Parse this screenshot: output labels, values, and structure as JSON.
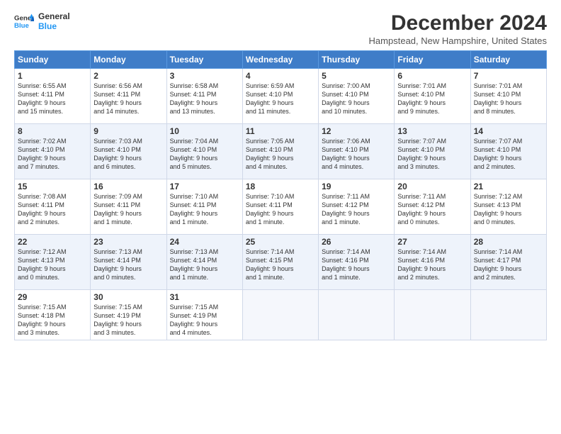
{
  "logo": {
    "line1": "General",
    "line2": "Blue"
  },
  "title": "December 2024",
  "location": "Hampstead, New Hampshire, United States",
  "days_of_week": [
    "Sunday",
    "Monday",
    "Tuesday",
    "Wednesday",
    "Thursday",
    "Friday",
    "Saturday"
  ],
  "weeks": [
    [
      {
        "day": "1",
        "info": "Sunrise: 6:55 AM\nSunset: 4:11 PM\nDaylight: 9 hours\nand 15 minutes."
      },
      {
        "day": "2",
        "info": "Sunrise: 6:56 AM\nSunset: 4:11 PM\nDaylight: 9 hours\nand 14 minutes."
      },
      {
        "day": "3",
        "info": "Sunrise: 6:58 AM\nSunset: 4:11 PM\nDaylight: 9 hours\nand 13 minutes."
      },
      {
        "day": "4",
        "info": "Sunrise: 6:59 AM\nSunset: 4:10 PM\nDaylight: 9 hours\nand 11 minutes."
      },
      {
        "day": "5",
        "info": "Sunrise: 7:00 AM\nSunset: 4:10 PM\nDaylight: 9 hours\nand 10 minutes."
      },
      {
        "day": "6",
        "info": "Sunrise: 7:01 AM\nSunset: 4:10 PM\nDaylight: 9 hours\nand 9 minutes."
      },
      {
        "day": "7",
        "info": "Sunrise: 7:01 AM\nSunset: 4:10 PM\nDaylight: 9 hours\nand 8 minutes."
      }
    ],
    [
      {
        "day": "8",
        "info": "Sunrise: 7:02 AM\nSunset: 4:10 PM\nDaylight: 9 hours\nand 7 minutes."
      },
      {
        "day": "9",
        "info": "Sunrise: 7:03 AM\nSunset: 4:10 PM\nDaylight: 9 hours\nand 6 minutes."
      },
      {
        "day": "10",
        "info": "Sunrise: 7:04 AM\nSunset: 4:10 PM\nDaylight: 9 hours\nand 5 minutes."
      },
      {
        "day": "11",
        "info": "Sunrise: 7:05 AM\nSunset: 4:10 PM\nDaylight: 9 hours\nand 4 minutes."
      },
      {
        "day": "12",
        "info": "Sunrise: 7:06 AM\nSunset: 4:10 PM\nDaylight: 9 hours\nand 4 minutes."
      },
      {
        "day": "13",
        "info": "Sunrise: 7:07 AM\nSunset: 4:10 PM\nDaylight: 9 hours\nand 3 minutes."
      },
      {
        "day": "14",
        "info": "Sunrise: 7:07 AM\nSunset: 4:10 PM\nDaylight: 9 hours\nand 2 minutes."
      }
    ],
    [
      {
        "day": "15",
        "info": "Sunrise: 7:08 AM\nSunset: 4:11 PM\nDaylight: 9 hours\nand 2 minutes."
      },
      {
        "day": "16",
        "info": "Sunrise: 7:09 AM\nSunset: 4:11 PM\nDaylight: 9 hours\nand 1 minute."
      },
      {
        "day": "17",
        "info": "Sunrise: 7:10 AM\nSunset: 4:11 PM\nDaylight: 9 hours\nand 1 minute."
      },
      {
        "day": "18",
        "info": "Sunrise: 7:10 AM\nSunset: 4:11 PM\nDaylight: 9 hours\nand 1 minute."
      },
      {
        "day": "19",
        "info": "Sunrise: 7:11 AM\nSunset: 4:12 PM\nDaylight: 9 hours\nand 1 minute."
      },
      {
        "day": "20",
        "info": "Sunrise: 7:11 AM\nSunset: 4:12 PM\nDaylight: 9 hours\nand 0 minutes."
      },
      {
        "day": "21",
        "info": "Sunrise: 7:12 AM\nSunset: 4:13 PM\nDaylight: 9 hours\nand 0 minutes."
      }
    ],
    [
      {
        "day": "22",
        "info": "Sunrise: 7:12 AM\nSunset: 4:13 PM\nDaylight: 9 hours\nand 0 minutes."
      },
      {
        "day": "23",
        "info": "Sunrise: 7:13 AM\nSunset: 4:14 PM\nDaylight: 9 hours\nand 0 minutes."
      },
      {
        "day": "24",
        "info": "Sunrise: 7:13 AM\nSunset: 4:14 PM\nDaylight: 9 hours\nand 1 minute."
      },
      {
        "day": "25",
        "info": "Sunrise: 7:14 AM\nSunset: 4:15 PM\nDaylight: 9 hours\nand 1 minute."
      },
      {
        "day": "26",
        "info": "Sunrise: 7:14 AM\nSunset: 4:16 PM\nDaylight: 9 hours\nand 1 minute."
      },
      {
        "day": "27",
        "info": "Sunrise: 7:14 AM\nSunset: 4:16 PM\nDaylight: 9 hours\nand 2 minutes."
      },
      {
        "day": "28",
        "info": "Sunrise: 7:14 AM\nSunset: 4:17 PM\nDaylight: 9 hours\nand 2 minutes."
      }
    ],
    [
      {
        "day": "29",
        "info": "Sunrise: 7:15 AM\nSunset: 4:18 PM\nDaylight: 9 hours\nand 3 minutes."
      },
      {
        "day": "30",
        "info": "Sunrise: 7:15 AM\nSunset: 4:19 PM\nDaylight: 9 hours\nand 3 minutes."
      },
      {
        "day": "31",
        "info": "Sunrise: 7:15 AM\nSunset: 4:19 PM\nDaylight: 9 hours\nand 4 minutes."
      },
      {
        "day": "",
        "info": ""
      },
      {
        "day": "",
        "info": ""
      },
      {
        "day": "",
        "info": ""
      },
      {
        "day": "",
        "info": ""
      }
    ]
  ]
}
